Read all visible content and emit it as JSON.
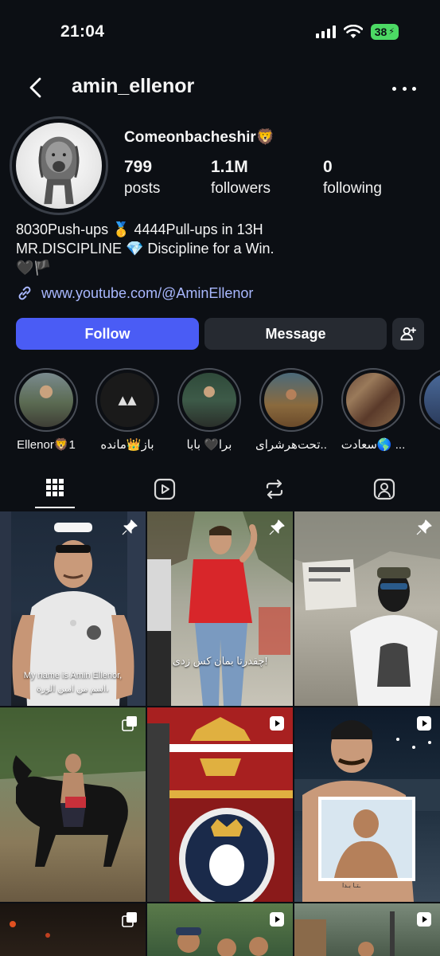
{
  "status_bar": {
    "time": "21:04",
    "battery": "38"
  },
  "header": {
    "username": "amin_ellenor"
  },
  "profile": {
    "display_name": "Comeonbacheshir🦁",
    "stats": [
      {
        "value": "799",
        "label": "posts"
      },
      {
        "value": "1.1M",
        "label": "followers"
      },
      {
        "value": "0",
        "label": "following"
      }
    ],
    "bio": [
      "8030Push-ups 🥇 4444Pull-ups in 13H",
      "MR.DISCIPLINE 💎 Discipline for a Win.",
      "🖤🏴"
    ],
    "link": "www.youtube.com/@AminEllenor"
  },
  "buttons": {
    "follow": "Follow",
    "message": "Message"
  },
  "highlights": [
    {
      "label": "Ellenor🦁1"
    },
    {
      "label": "باز👑مانده"
    },
    {
      "label": "برا🖤 بابا"
    },
    {
      "label": "تحت‌هرشرای..."
    },
    {
      "label": "سعادت🌎 ..."
    }
  ],
  "grid_captions": {
    "post1_line1": "My name is Amin Ellenor,",
    "post1_line2": "اسم من امین الورة،",
    "post2": "چقدرتا بمان کس زدی!"
  },
  "colors": {
    "follow_button": "#4a5cf5",
    "link": "#a9b8ff",
    "battery": "#4cd964"
  }
}
